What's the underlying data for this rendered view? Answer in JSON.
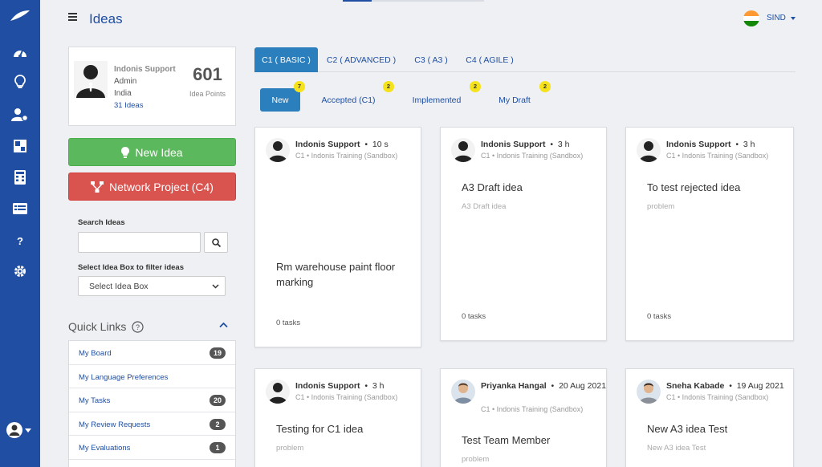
{
  "header": {
    "title": "Ideas",
    "user_code": "SIND"
  },
  "profile": {
    "name": "Indonis Support",
    "role": "Admin",
    "country": "India",
    "ideas_link": "31 Ideas",
    "points": "601",
    "points_label": "Idea Points"
  },
  "actions": {
    "new_idea": "New Idea",
    "network_project": "Network Project (C4)"
  },
  "search": {
    "label": "Search Ideas",
    "value": "",
    "filter_label": "Select Idea Box to filter ideas",
    "filter_selected": "Select Idea Box"
  },
  "quick_links": {
    "title": "Quick Links",
    "items": [
      {
        "label": "My Board",
        "badge": "19"
      },
      {
        "label": "My Language Preferences",
        "badge": ""
      },
      {
        "label": "My Tasks",
        "badge": "20"
      },
      {
        "label": "My Review Requests",
        "badge": "2"
      },
      {
        "label": "My Evaluations",
        "badge": "1"
      }
    ]
  },
  "tabs": [
    "C1 ( BASIC )",
    "C2 ( ADVANCED )",
    "C3 ( A3 )",
    "C4 ( AGILE )"
  ],
  "subtabs": [
    {
      "label": "New",
      "badge": "7"
    },
    {
      "label": "Accepted (C1)",
      "badge": "2"
    },
    {
      "label": "Implemented",
      "badge": "2"
    },
    {
      "label": "My Draft",
      "badge": "2"
    }
  ],
  "cards": [
    {
      "author": "Indonis Support",
      "time": "10 s",
      "meta": "C1  •  Indonis Training (Sandbox)",
      "title": "Rm warehouse paint floor marking",
      "desc": "",
      "tasks": "0 tasks"
    },
    {
      "author": "Indonis Support",
      "time": "3 h",
      "meta": "C1  •  Indonis Training (Sandbox)",
      "title": "A3 Draft idea",
      "desc": "A3 Draft idea",
      "tasks": "0 tasks"
    },
    {
      "author": "Indonis Support",
      "time": "3 h",
      "meta": "C1  •  Indonis Training (Sandbox)",
      "title": "To test rejected idea",
      "desc": "problem",
      "tasks": "0 tasks"
    },
    {
      "author": "Indonis Support",
      "time": "3 h",
      "meta": "C1  •  Indonis Training (Sandbox)",
      "title": "Testing for C1 idea",
      "desc": "problem",
      "tasks": ""
    },
    {
      "author": "Priyanka Hangal",
      "time": "20 Aug 2021",
      "meta": "C1  •  Indonis Training (Sandbox)",
      "title": "Test Team Member",
      "desc": "problem",
      "tasks": ""
    },
    {
      "author": "Sneha Kabade",
      "time": "19 Aug 2021",
      "meta": "C1  •  Indonis Training (Sandbox)",
      "title": "New A3 idea Test",
      "desc": "New A3 idea Test",
      "tasks": ""
    }
  ],
  "rail_icons": [
    "logo-icon",
    "dashboard-icon",
    "lightbulb-icon",
    "user-settings-icon",
    "board-icon",
    "calculator-icon",
    "list-icon",
    "help-icon",
    "gear-icon",
    "user-avatar-icon"
  ]
}
